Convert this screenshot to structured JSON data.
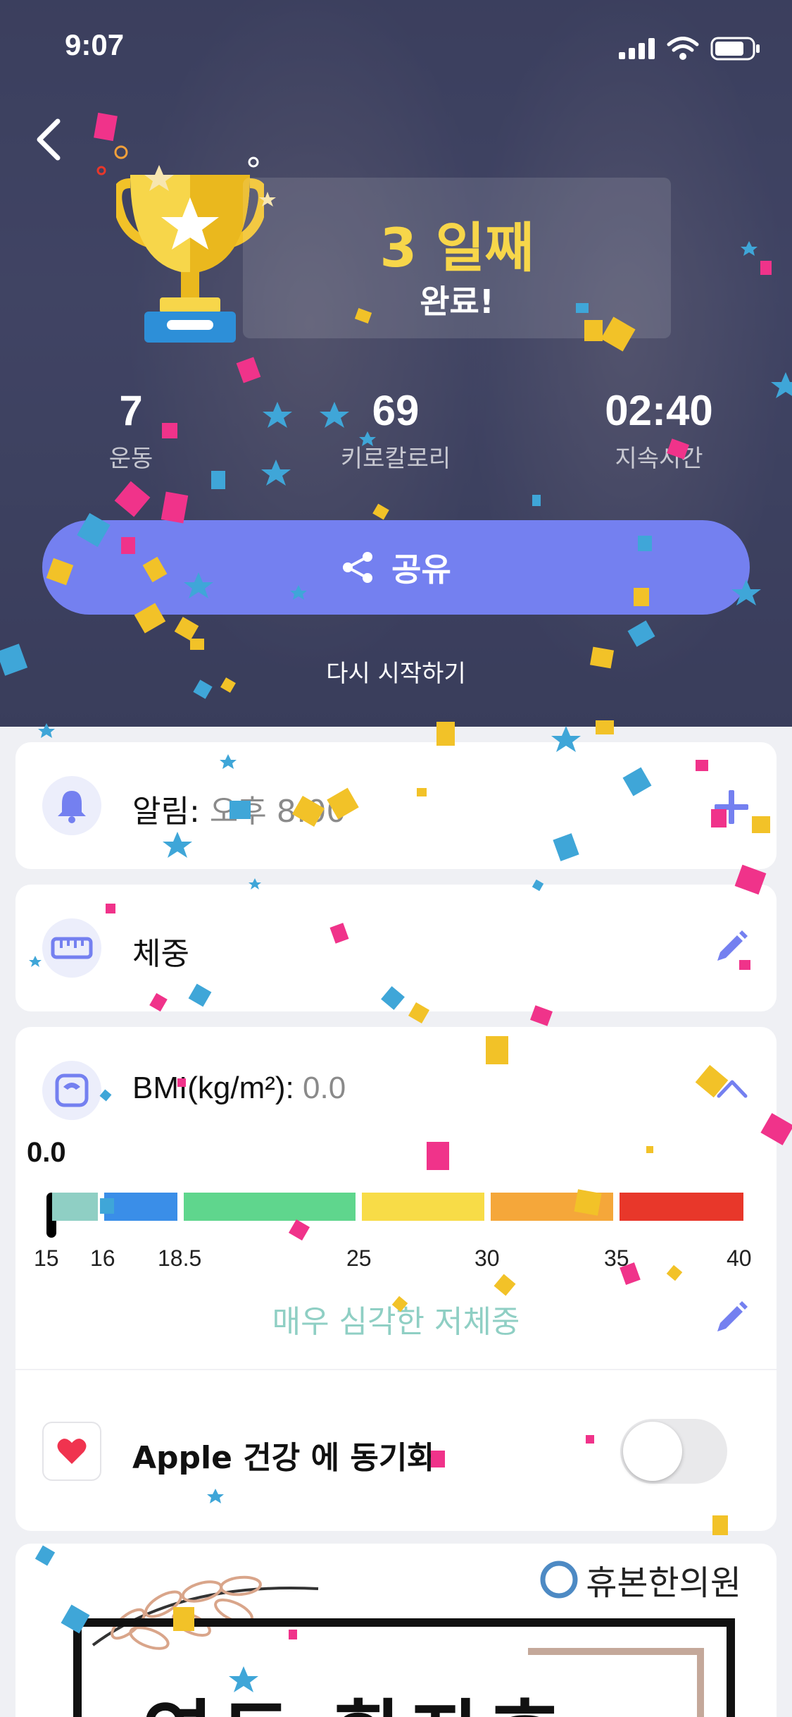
{
  "status_bar": {
    "time": "9:07"
  },
  "result": {
    "day_title": "3 일째",
    "day_subtitle": "완료!",
    "stats": [
      {
        "value": "7",
        "label": "운동"
      },
      {
        "value": "69",
        "label": "키로칼로리"
      },
      {
        "value": "02:40",
        "label": "지속시간"
      }
    ],
    "share_label": "공유",
    "restart_label": "다시 시작하기"
  },
  "reminder": {
    "label": "알림:",
    "value": "오후 8:00"
  },
  "weight": {
    "label": "체중"
  },
  "bmi": {
    "label": "BMI(kg/m²):",
    "value": "0.0",
    "marker_value": "0.0",
    "ticks": [
      "15",
      "16",
      "18.5",
      "25",
      "30",
      "35",
      "40"
    ],
    "status_text": "매우 심각한 저체중",
    "colors": [
      "#8fcfc4",
      "#3a8ee8",
      "#5fd68d",
      "#f8dc47",
      "#f5a73a",
      "#e8372a"
    ]
  },
  "health_sync": {
    "label": "Apple 건강 에 동기화",
    "enabled": false
  },
  "ad": {
    "brand": "휴본한의원",
    "headline": "연도 환자후"
  },
  "accent_color": "#7480f0",
  "gold_color": "#f7d64a"
}
